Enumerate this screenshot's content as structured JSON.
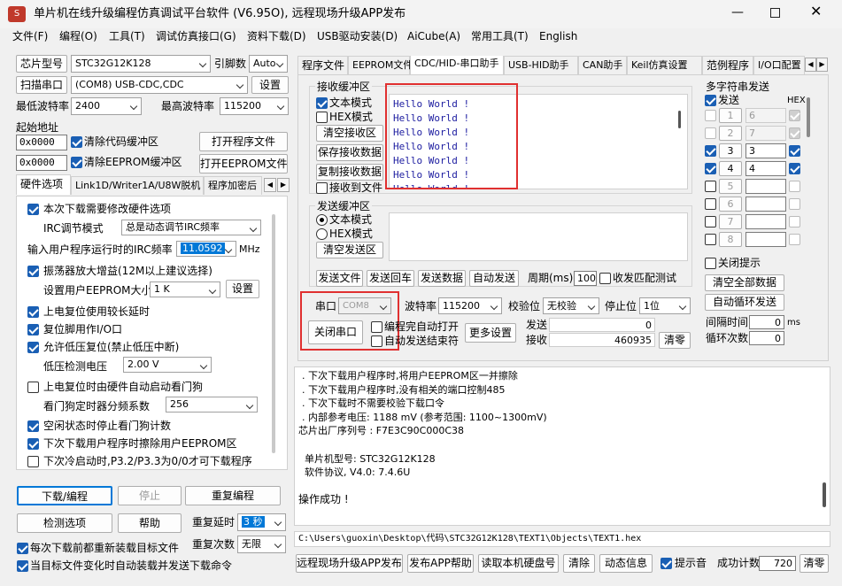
{
  "window": {
    "title": "单片机在线升级编程仿真调试平台软件 (V6.95O), 远程现场升级APP发布"
  },
  "menu": [
    "文件(F)",
    "编程(O)",
    "工具(T)",
    "调试仿真接口(G)",
    "资料下载(D)",
    "USB驱动安装(D)",
    "AiCube(A)",
    "常用工具(T)",
    "English"
  ],
  "left": {
    "mcu_label": "芯片型号",
    "mcu_value": "STC32G12K128",
    "pins_label": "引脚数",
    "pins_value": "Auto",
    "scan_btn": "扫描串口",
    "port_value": "(COM8) USB-CDC,CDC",
    "settings_btn": "设置",
    "min_baud_label": "最低波特率",
    "min_baud": "2400",
    "max_baud_label": "最高波特率",
    "max_baud": "115200",
    "start_addr_label": "起始地址",
    "addr1": "0x0000",
    "clear_code": "清除代码缓冲区",
    "open_prog": "打开程序文件",
    "addr2": "0x0000",
    "clear_eeprom": "清除EEPROM缓冲区",
    "open_eeprom": "打开EEPROM文件",
    "tabs": [
      "硬件选项",
      "Link1D/Writer1A/U8W脱机",
      "程序加密后"
    ],
    "opts": {
      "o1": "本次下载需要修改硬件选项",
      "irc_mode_label": "IRC调节模式",
      "irc_mode": "总是动态调节IRC频率",
      "irc_freq_label": "输入用户程序运行时的IRC频率",
      "irc_freq": "11.0592",
      "mhz": "MHz",
      "o2": "振荡器放大增益(12M以上建议选择)",
      "eeprom_size_label": "设置用户EEPROM大小",
      "eeprom_size": "1 K",
      "set_btn": "设置",
      "o3": "上电复位使用较长延时",
      "o4": "复位脚用作I/O口",
      "o5": "允许低压复位(禁止低压中断)",
      "lvd_label": "低压检测电压",
      "lvd": "2.00 V",
      "o6": "上电复位时由硬件自动启动看门狗",
      "wdt_label": "看门狗定时器分频系数",
      "wdt": "256",
      "o7": "空闲状态时停止看门狗计数",
      "o8": "下次下载用户程序时擦除用户EEPROM区",
      "o9": "下次冷启动时,P3.2/P3.3为0/0才可下载程序"
    },
    "download_btn": "下载/编程",
    "stop_btn": "停止",
    "redo_btn": "重复编程",
    "check_btn": "检测选项",
    "help_btn": "帮助",
    "delay_label": "重复延时",
    "delay": "3 秒",
    "count_label": "重复次数",
    "count": "无限",
    "reload1": "每次下载前都重新装载目标文件",
    "reload2": "当目标文件变化时自动装载并发送下载命令"
  },
  "right": {
    "tabs": [
      "程序文件",
      "EEPROM文件",
      "CDC/HID-串口助手",
      "USB-HID助手",
      "CAN助手",
      "Keil仿真设置",
      "范例程序",
      "I/O口配置"
    ],
    "recv_group": "接收缓冲区",
    "text_mode": "文本模式",
    "hex_mode": "HEX模式",
    "clear_recv": "清空接收区",
    "save_recv": "保存接收数据",
    "copy_recv": "复制接收数据",
    "recv_to_file": "接收到文件",
    "recv_lines": [
      "Hello World !",
      "Hello World !",
      "Hello World !",
      "Hello World !",
      "Hello World !",
      "Hello World !"
    ],
    "send_group": "发送缓冲区",
    "send_text": "文本模式",
    "send_hex": "HEX模式",
    "clear_send": "清空发送区",
    "send_file": "发送文件",
    "send_enter": "发送回车",
    "send_data": "发送数据",
    "auto_send": "自动发送",
    "period_label": "周期(ms)",
    "period": "100",
    "recv_match": "收发匹配测试",
    "port_label": "串口",
    "port": "COM8",
    "close_port": "关闭串口",
    "baud_label": "波特率",
    "baud": "115200",
    "parity_label": "校验位",
    "parity": "无校验",
    "stop_label": "停止位",
    "stopbits": "1位",
    "auto_open": "编程完自动打开",
    "auto_end": "自动发送结束符",
    "more": "更多设置",
    "send_cnt_label": "发送",
    "send_cnt": "0",
    "recv_cnt_label": "接收",
    "recv_cnt": "460935",
    "clear_cnt": "清零",
    "multi": {
      "title": "多字符串发送",
      "send": "发送",
      "hex": "HEX",
      "rows": [
        {
          "n": "1",
          "v": "6"
        },
        {
          "n": "2",
          "v": "7"
        },
        {
          "n": "3",
          "v": "3"
        },
        {
          "n": "4",
          "v": "4"
        },
        {
          "n": "5",
          "v": ""
        },
        {
          "n": "6",
          "v": ""
        },
        {
          "n": "7",
          "v": ""
        },
        {
          "n": "8",
          "v": ""
        }
      ],
      "close_tip": "关闭提示",
      "clear_all": "清空全部数据",
      "auto_loop": "自动循环发送",
      "interval_label": "间隔时间",
      "interval": "0",
      "ms": "ms",
      "loops_label": "循环次数",
      "loops": "0"
    }
  },
  "log": {
    "lines": [
      ". 下次下载用户程序时,将用户EEPROM区一并擦除",
      ". 下次下载用户程序时,没有相关的端口控制485",
      ". 下次下载时不需要校验下载口令",
      ". 内部参考电压: 1188 mV (参考范围: 1100~1300mV)",
      "芯片出厂序列号 : F7E3C90C000C38",
      "",
      "  单片机型号: STC32G12K128",
      "  软件协议, V4.0: 7.4.6U",
      "",
      "操作成功 !"
    ],
    "path": "C:\\Users\\guoxin\\Desktop\\代码\\STC32G12K128\\TEXT1\\Objects\\TEXT1.hex"
  },
  "bottom": {
    "publish": "远程现场升级APP发布",
    "publish_help": "发布APP帮助",
    "read_disk": "读取本机硬盘号",
    "clear": "清除",
    "anim": "动态信息",
    "beep": "提示音",
    "success_label": "成功计数",
    "success": "720",
    "clear2": "清零"
  }
}
